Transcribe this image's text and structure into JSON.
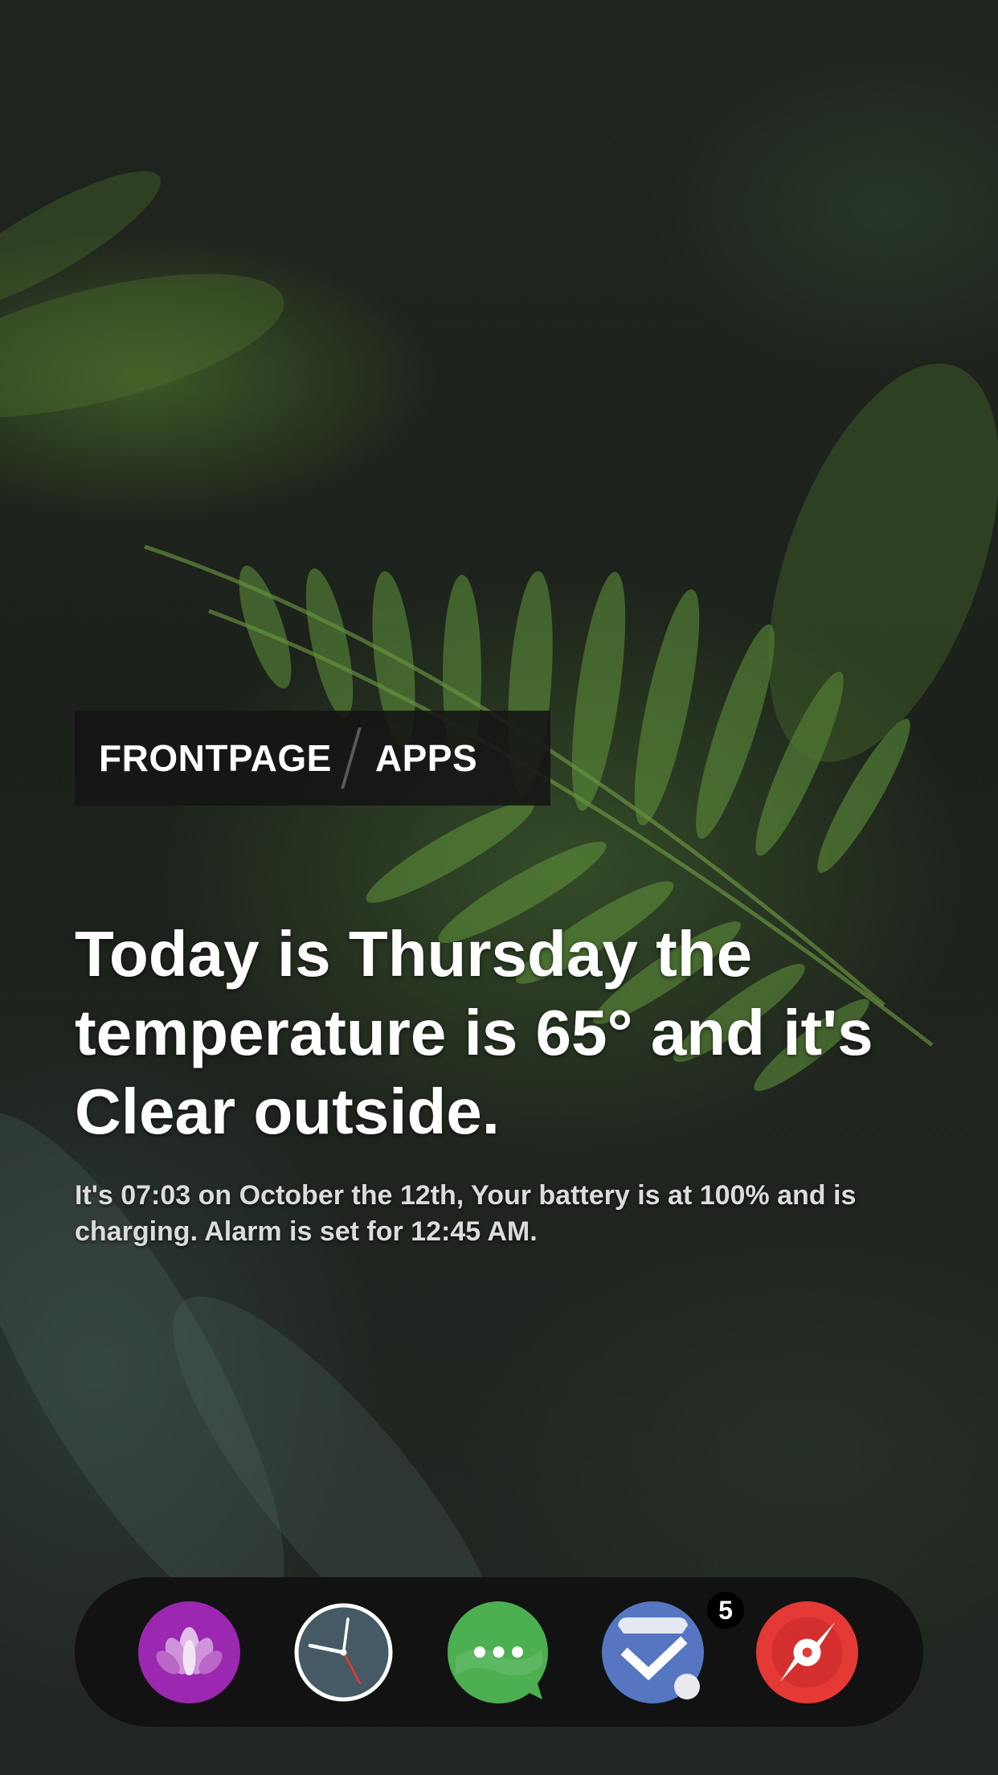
{
  "tabs": {
    "frontpage": "FRONTPAGE",
    "apps": "APPS"
  },
  "summary": {
    "headline": "Today is Thursday the temperature is 65° and it's Clear outside.",
    "details": "It's 07:03 on October the 12th, Your battery is at 100% and is charging. Alarm is set for 12:45 AM."
  },
  "dock": {
    "apps": [
      {
        "icon": "lotus-icon",
        "color": "#9c27b0"
      },
      {
        "icon": "clock-icon",
        "color": "#455a64"
      },
      {
        "icon": "messages-icon",
        "color": "#4caf50"
      },
      {
        "icon": "inbox-check-icon",
        "color": "#5676c2",
        "badge": "5"
      },
      {
        "icon": "compass-icon",
        "color": "#e53935"
      }
    ]
  }
}
